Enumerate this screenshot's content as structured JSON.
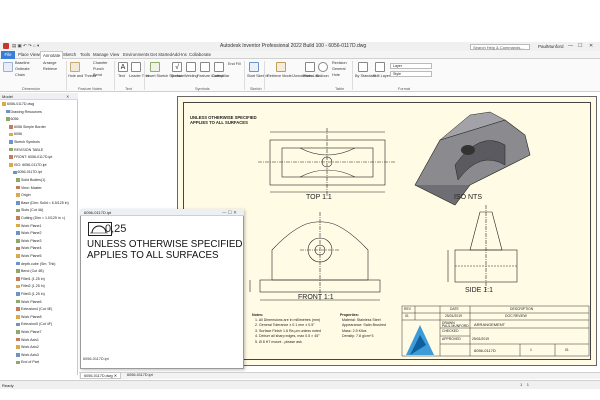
{
  "window": {
    "title": "Autodesk Inventor Professional 2022 Build 100 - 6056-0117D.dwg",
    "search_placeholder": "Search Help & Commands...",
    "user": "PaulMunford",
    "min": "—",
    "max": "☐",
    "close": "✕"
  },
  "tabs": [
    {
      "label": "File"
    },
    {
      "label": "Place Views"
    },
    {
      "label": "Annotate"
    },
    {
      "label": "Sketch"
    },
    {
      "label": "Tools"
    },
    {
      "label": "Manage"
    },
    {
      "label": "View"
    },
    {
      "label": "Environments"
    },
    {
      "label": "Get Started"
    },
    {
      "label": "Add-Ins"
    },
    {
      "label": "Collaborate"
    }
  ],
  "ribbon": {
    "dimension": {
      "label": "Dimension",
      "items": [
        "Baseline",
        "Ordinate",
        "Chain",
        "Arrange",
        "Retrieve"
      ]
    },
    "feature_notes": {
      "label": "Feature Notes",
      "items": [
        "Hole and Thread",
        "Chamfer",
        "Punch",
        "Bend"
      ]
    },
    "text": {
      "label": "Text",
      "items": [
        "Text",
        "Leader Text"
      ]
    },
    "symbols": {
      "label": "Symbols",
      "items": [
        "Insert Sketch Symbol",
        "Surface",
        "Welding",
        "Feature Control",
        "Caterpillar",
        "End Fill"
      ]
    },
    "sketch": {
      "label": "Sketch",
      "items": [
        "Start Sketch"
      ]
    },
    "table": {
      "label": "Table",
      "items": [
        "Retrieve Model Annotations",
        "Parts List",
        "Balloon",
        "Revision",
        "General",
        "Hole",
        "Revision"
      ]
    },
    "format": {
      "label": "Format",
      "items": [
        "Layer",
        "Style",
        "Edit Layers",
        "By Standard"
      ]
    }
  },
  "browser": {
    "header": "Model",
    "items": [
      {
        "label": "6056-0117D.dwg",
        "indent": 0
      },
      {
        "label": "Drawing Resources",
        "indent": 1
      },
      {
        "label": "6056",
        "indent": 1
      },
      {
        "label": "6056 Simple Border",
        "indent": 2
      },
      {
        "label": "6056",
        "indent": 2
      },
      {
        "label": "Sketch Symbols",
        "indent": 2
      },
      {
        "label": "REVISION TABLE",
        "indent": 2
      },
      {
        "label": "FRONT: 6056-0117D.ipt",
        "indent": 2
      },
      {
        "label": "ISO: 6056-0117D.ipt",
        "indent": 2
      },
      {
        "label": "6056-0117D.ipt",
        "indent": 3
      },
      {
        "label": "Solid Bodies(1)",
        "indent": 4
      },
      {
        "label": "View: Master",
        "indent": 4
      },
      {
        "label": "Origin",
        "indent": 4
      },
      {
        "label": "Base (Dim: Solid ≈ 6.5/125 in)",
        "indent": 4
      },
      {
        "label": "Slots (Cut 4A)",
        "indent": 4
      },
      {
        "label": "Cutting (Dim ≈ 1.0/125 in ×)",
        "indent": 4
      },
      {
        "label": "Work Plane1",
        "indent": 4
      },
      {
        "label": "Work Plane2",
        "indent": 4
      },
      {
        "label": "Work Plane3",
        "indent": 4
      },
      {
        "label": "Work Plane4",
        "indent": 4
      },
      {
        "label": "Work Plane5",
        "indent": 4
      },
      {
        "label": "depth.cube (Sm. Thk)",
        "indent": 4
      },
      {
        "label": "Bend (Cut 4B)",
        "indent": 4
      },
      {
        "label": "Fillet1 (1.25 in)",
        "indent": 4
      },
      {
        "label": "Fillet2 (1.25 in)",
        "indent": 4
      },
      {
        "label": "Fillet3 (1.25 in)",
        "indent": 4
      },
      {
        "label": "Work Plane6",
        "indent": 4
      },
      {
        "label": "Extrusion4 (Cut 4E)",
        "indent": 4
      },
      {
        "label": "Work Plane8",
        "indent": 4
      },
      {
        "label": "Extrusion5 (Cut 4F)",
        "indent": 4
      },
      {
        "label": "Work Plane7",
        "indent": 4
      },
      {
        "label": "Work Axis1",
        "indent": 4
      },
      {
        "label": "Work Axis2",
        "indent": 4
      },
      {
        "label": "Work Axis3",
        "indent": 4
      },
      {
        "label": "End of Part",
        "indent": 4
      }
    ]
  },
  "drawing": {
    "notes_title_1": "UNLESS OTHERWISE SPECIFIED",
    "notes_title_2": "APPLIES TO ALL SURFACES",
    "views": {
      "top": "TOP 1:1",
      "iso": "ISO NTS",
      "front": "FRONT 1:1",
      "side": "SIDE 1:1"
    },
    "notes_heading": "Notes:",
    "notes": [
      "1. All Dimensions are in millimetres (mm)",
      "2. General Tolerance ± 0.1 mm ± 0.5°",
      "3. Surface Finish 1.6 Ra µm unless noted",
      "4. Deburr all sharp edges, max 0.5 × 45°",
      "5. Ø 8 H7 mount - please ask"
    ],
    "properties_heading": "Properties:",
    "properties": [
      "Material: Stainless Steel",
      "Appearance: Satin Brushed",
      "Mass: 2.5 Kilos",
      "Density: 7.8 g/cm^3"
    ],
    "revision_table": {
      "header": [
        "REV",
        "DATE",
        "DESCRIPTION"
      ],
      "row": [
        "01",
        "25/01/2019",
        "DOC REVIEW"
      ]
    },
    "title_block": {
      "drawn": "DRAWN",
      "drawn_by": "PAUL MUNFORD",
      "checked": "CHECKED",
      "approved": "APPROVED",
      "date": "25/01/2019",
      "title": "ARRANGEMENT",
      "dwg_no": "6056-0117D",
      "sheet": "1",
      "rev": "01"
    }
  },
  "popup": {
    "filename": "6056-0117D.ipt",
    "finish_value": "0,25",
    "line1": "UNLESS OTHERWISE SPECIFIED",
    "line2": "APPLIES TO ALL SURFACES",
    "bottom_label": "6056-0117D.ipt",
    "close": "✕",
    "maximize": "☐",
    "minimize": "—"
  },
  "doc_tabs": [
    {
      "label": "6056-0117D.dwg ✕"
    },
    {
      "label": "6056-0117D.ipt"
    }
  ],
  "status": {
    "left": "Ready",
    "right_1": "1",
    "right_2": "1"
  },
  "colors": {
    "accent": "#3a7dd6",
    "sheet": "#fffbe5",
    "part_fill": "#7a7a80"
  }
}
